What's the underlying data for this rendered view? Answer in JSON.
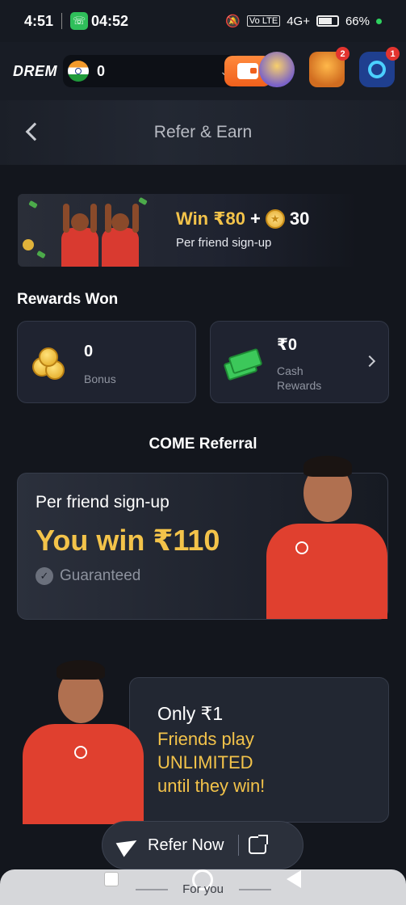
{
  "status_bar": {
    "time": "4:51",
    "call_time": "04:52",
    "network": "4G+",
    "volte": "Vo LTE",
    "battery": "66%"
  },
  "app_bar": {
    "logo": "DREM",
    "balance": "0",
    "icons": [
      "wallet-icon",
      "jar-icon",
      "gift-icon",
      "support-icon"
    ],
    "gift_badge": "2",
    "support_badge": "1"
  },
  "header": {
    "title": "Refer & Earn"
  },
  "promo": {
    "win_text": "Win ₹80",
    "plus": "+",
    "coins": "30",
    "subtitle": "Per friend sign-up"
  },
  "rewards": {
    "title": "Rewards Won",
    "bonus_value": "0",
    "bonus_label": "Bonus",
    "cash_value": "₹0",
    "cash_label": "Cash Rewards"
  },
  "referral": {
    "section_title": "COME Referral",
    "subtitle": "Per friend sign-up",
    "win": "You win ₹110",
    "guaranteed": "Guaranteed"
  },
  "only_card": {
    "title": "Only ₹1",
    "line1": "Friends play",
    "line2": "UNLIMITED",
    "line3": "until they win!"
  },
  "refer_button": {
    "label": "Refer Now"
  },
  "nav": {
    "label": "For you"
  },
  "colors": {
    "background": "#13161d",
    "accent_gold": "#f3c34a",
    "wallet_orange": "#f0601c",
    "jersey_red": "#e0402f"
  }
}
